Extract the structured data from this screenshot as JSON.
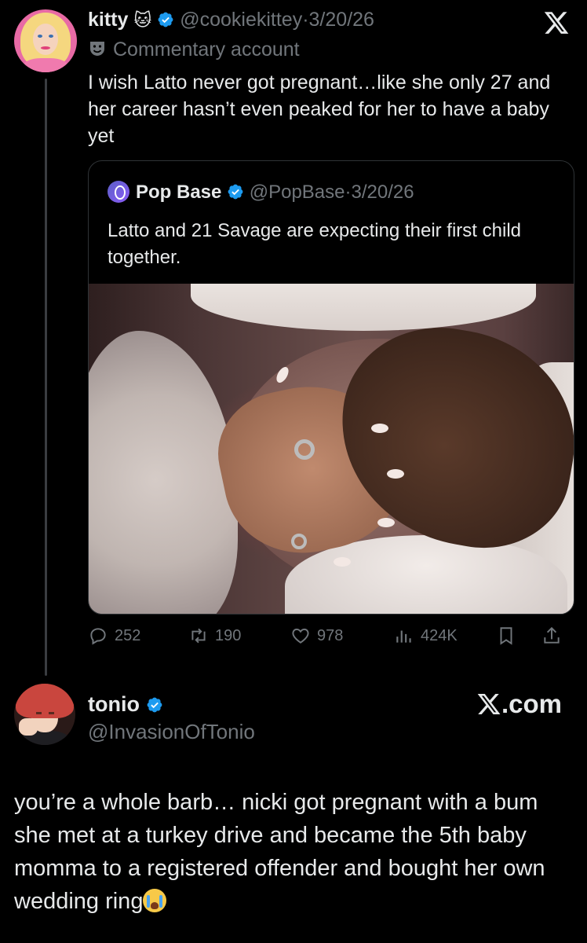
{
  "tweet1": {
    "display_name": "kitty",
    "name_emoji": "🐱",
    "handle": "@cookiekittey",
    "date": "3/20/26",
    "label": "Commentary account",
    "text": "I wish Latto never got pregnant…like she only 27 and her career hasn’t even peaked for her to have a baby yet"
  },
  "quoted": {
    "display_name": "Pop Base",
    "handle": "@PopBase",
    "date": "3/20/26",
    "text": "Latto and 21 Savage are expecting their first child together."
  },
  "actions": {
    "replies": "252",
    "reposts": "190",
    "likes": "978",
    "views": "424K"
  },
  "tweet2": {
    "display_name": "tonio",
    "handle": "@InvasionOfTonio",
    "source": ".com",
    "text": "you’re a whole barb… nicki got pregnant with a bum she met at a turkey drive and became the 5th baby momma to a registered offender and bought her own wedding ring"
  },
  "icons": {
    "verified": "verified-badge-icon",
    "x_logo": "x-logo-icon",
    "reply": "reply-icon",
    "repost": "repost-icon",
    "like": "heart-icon",
    "views": "views-icon",
    "bookmark": "bookmark-icon",
    "share": "share-icon",
    "crying": "loudly-crying-face-emoji"
  },
  "colors": {
    "background": "#000000",
    "text": "#e7e9ea",
    "muted": "#71767b",
    "verified": "#1d9bf0",
    "border": "#2f3336"
  }
}
